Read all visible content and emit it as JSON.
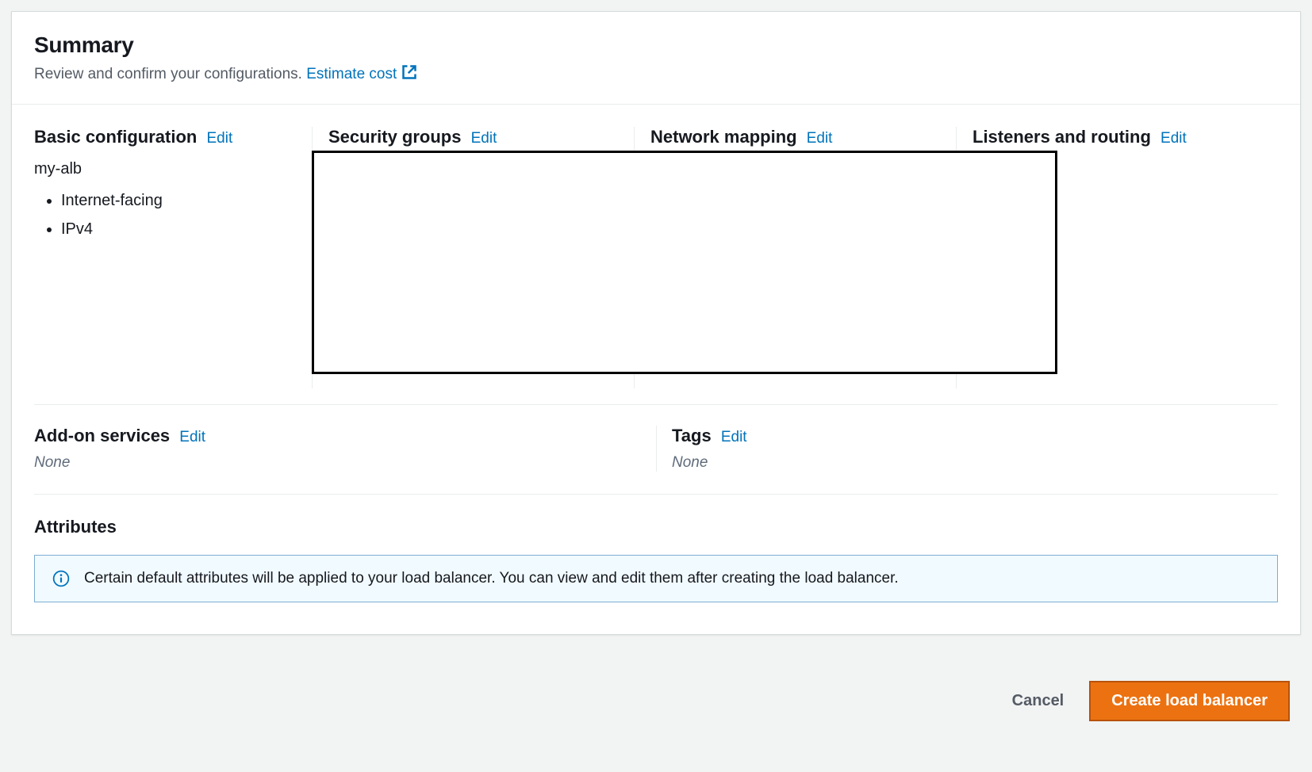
{
  "header": {
    "title": "Summary",
    "subtitle_prefix": "Review and confirm your configurations. ",
    "estimate_link": "Estimate cost"
  },
  "columns": {
    "basic": {
      "title": "Basic configuration",
      "edit": "Edit",
      "name": "my-alb",
      "items": [
        "Internet-facing",
        "IPv4"
      ]
    },
    "security": {
      "title": "Security groups",
      "edit": "Edit"
    },
    "network": {
      "title": "Network mapping",
      "edit": "Edit"
    },
    "listeners": {
      "title": "Listeners and routing",
      "edit": "Edit"
    }
  },
  "addons": {
    "title": "Add-on services",
    "edit": "Edit",
    "value": "None"
  },
  "tags": {
    "title": "Tags",
    "edit": "Edit",
    "value": "None"
  },
  "attributes": {
    "title": "Attributes",
    "banner": "Certain default attributes will be applied to your load balancer. You can view and edit them after creating the load balancer."
  },
  "footer": {
    "cancel": "Cancel",
    "create": "Create load balancer"
  }
}
